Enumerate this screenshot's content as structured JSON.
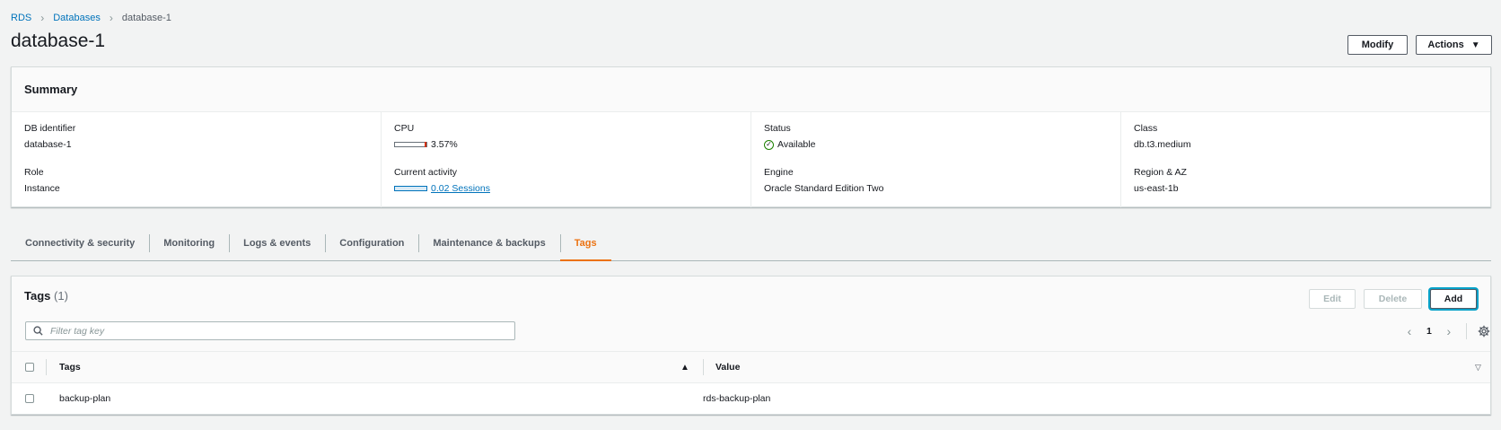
{
  "breadcrumb": {
    "root": "RDS",
    "parent": "Databases",
    "current": "database-1"
  },
  "page": {
    "title": "database-1"
  },
  "header_actions": {
    "modify": "Modify",
    "actions": "Actions"
  },
  "summary": {
    "title": "Summary",
    "db_identifier": {
      "label": "DB identifier",
      "value": "database-1"
    },
    "role": {
      "label": "Role",
      "value": "Instance"
    },
    "cpu": {
      "label": "CPU",
      "value": "3.57%"
    },
    "activity": {
      "label": "Current activity",
      "value": "0.02 Sessions"
    },
    "status": {
      "label": "Status",
      "value": "Available",
      "color": "#1d8102"
    },
    "engine": {
      "label": "Engine",
      "value": "Oracle Standard Edition Two"
    },
    "class": {
      "label": "Class",
      "value": "db.t3.medium"
    },
    "region": {
      "label": "Region & AZ",
      "value": "us-east-1b"
    }
  },
  "tabs": [
    {
      "label": "Connectivity & security"
    },
    {
      "label": "Monitoring"
    },
    {
      "label": "Logs & events"
    },
    {
      "label": "Configuration"
    },
    {
      "label": "Maintenance & backups"
    },
    {
      "label": "Tags",
      "active": true
    }
  ],
  "tags_panel": {
    "title": "Tags",
    "count": "(1)",
    "edit": "Edit",
    "delete": "Delete",
    "add": "Add",
    "filter_placeholder": "Filter tag key",
    "page": "1",
    "columns": {
      "key": "Tags",
      "value": "Value"
    },
    "rows": [
      {
        "key": "backup-plan",
        "value": "rds-backup-plan"
      }
    ]
  },
  "colors": {
    "accent": "#ec7211",
    "link": "#0073bb",
    "success": "#1d8102"
  }
}
